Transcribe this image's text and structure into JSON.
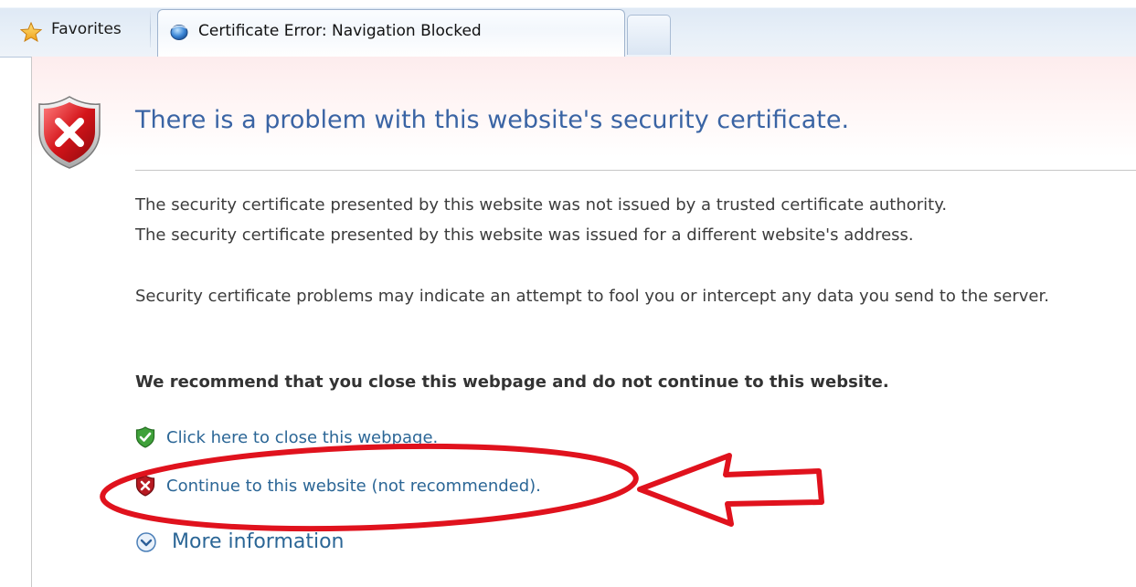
{
  "tabs": {
    "favorites_label": "Favorites",
    "active_tab_title": "Certificate Error: Navigation Blocked"
  },
  "page": {
    "headline": "There is a problem with this website's security certificate.",
    "details_line1": "The security certificate presented by this website was not issued by a trusted certificate authority.",
    "details_line2": "The security certificate presented by this website was issued for a different website's address.",
    "warning": "Security certificate problems may indicate an attempt to fool you or intercept any data you send to the server.",
    "recommendation": "We recommend that you close this webpage and do not continue to this website.",
    "close_link": "Click here to close this webpage.",
    "continue_link": "Continue to this website (not recommended).",
    "more_info_link": "More information"
  },
  "colors": {
    "headline": "#3a64a4",
    "link": "#2b6696",
    "annotation": "#e0121d"
  },
  "icons": {
    "favorites": "star-icon",
    "tab": "globe-icon",
    "header": "red-shield-x-icon",
    "close": "green-shield-check-icon",
    "continue": "red-shield-x-icon",
    "more": "chevron-down-circle-icon"
  }
}
